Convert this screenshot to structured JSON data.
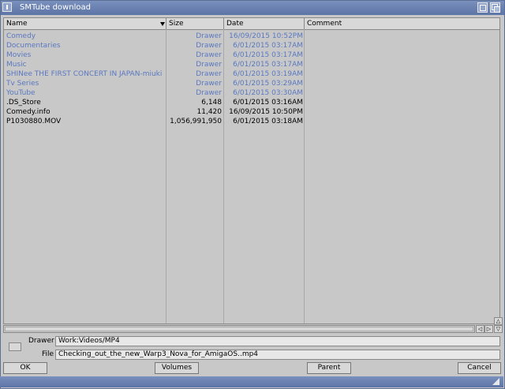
{
  "window": {
    "title": "SMTube download"
  },
  "columns": {
    "name": "Name",
    "size": "Size",
    "date": "Date",
    "comment": "Comment"
  },
  "rows": [
    {
      "name": "Comedy",
      "size": "Drawer",
      "date": "16/09/2015 10:52PM",
      "comment": "",
      "type": "drawer"
    },
    {
      "name": "Documentaries",
      "size": "Drawer",
      "date": "6/01/2015 03:17AM",
      "comment": "",
      "type": "drawer"
    },
    {
      "name": "Movies",
      "size": "Drawer",
      "date": "6/01/2015 03:17AM",
      "comment": "",
      "type": "drawer"
    },
    {
      "name": "Music",
      "size": "Drawer",
      "date": "6/01/2015 03:17AM",
      "comment": "",
      "type": "drawer"
    },
    {
      "name": "SHINee THE FIRST CONCERT IN JAPAN-miuki",
      "size": "Drawer",
      "date": "6/01/2015 03:19AM",
      "comment": "",
      "type": "drawer"
    },
    {
      "name": "Tv Series",
      "size": "Drawer",
      "date": "6/01/2015 03:29AM",
      "comment": "",
      "type": "drawer"
    },
    {
      "name": "YouTube",
      "size": "Drawer",
      "date": "6/01/2015 03:30AM",
      "comment": "",
      "type": "drawer"
    },
    {
      "name": ".DS_Store",
      "size": "6,148",
      "date": "6/01/2015 03:16AM",
      "comment": "",
      "type": "file"
    },
    {
      "name": "Comedy.info",
      "size": "11,420",
      "date": "16/09/2015 10:50PM",
      "comment": "",
      "type": "file"
    },
    {
      "name": "P1030880.MOV",
      "size": "1,056,991,950",
      "date": "6/01/2015 03:18AM",
      "comment": "",
      "type": "file"
    }
  ],
  "drawer": {
    "label": "Drawer",
    "value": "Work:Videos/MP4"
  },
  "file": {
    "label": "File",
    "value": "Checking_out_the_new_Warp3_Nova_for_AmigaOS..mp4"
  },
  "buttons": {
    "ok": "OK",
    "volumes": "Volumes",
    "parent": "Parent",
    "cancel": "Cancel"
  },
  "colors": {
    "titlebar": "#6a82b4",
    "drawer_text": "#5a78c0",
    "background": "#c8c8c8"
  }
}
